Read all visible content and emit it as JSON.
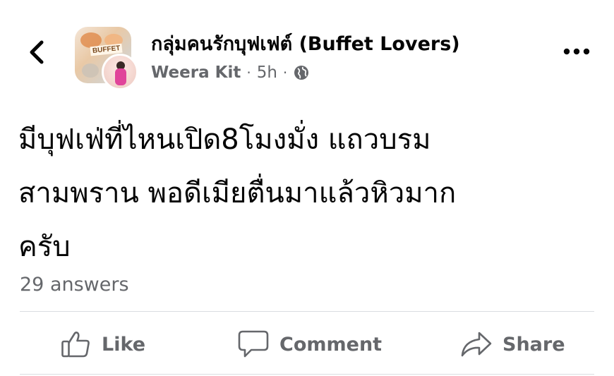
{
  "header": {
    "group_name": "กลุ่มคนรักบุฟเฟต์ (Buffet Lovers)",
    "group_avatar_text": "BUFFET",
    "author": "Weera Kit",
    "separator": "·",
    "time": "5h",
    "icons": {
      "back": "chevron-left-icon",
      "privacy": "globe-icon",
      "more": "more-horizontal-icon"
    }
  },
  "post": {
    "lines": [
      "มีบุฟเฟ่ที่ไหนเปิด8โมงมั่ง แถวบรม",
      "สามพราน พอดีเมียตื่นมาแล้วหิวมาก",
      "ครับ"
    ],
    "answers": "29 answers"
  },
  "actions": {
    "like_label": "Like",
    "comment_label": "Comment",
    "share_label": "Share",
    "icons": {
      "like": "thumbs-up-icon",
      "comment": "comment-bubble-icon",
      "share": "share-arrow-icon"
    }
  },
  "colors": {
    "text_primary": "#050505",
    "text_secondary": "#65676b",
    "divider": "#dadde1",
    "background": "#ffffff"
  }
}
